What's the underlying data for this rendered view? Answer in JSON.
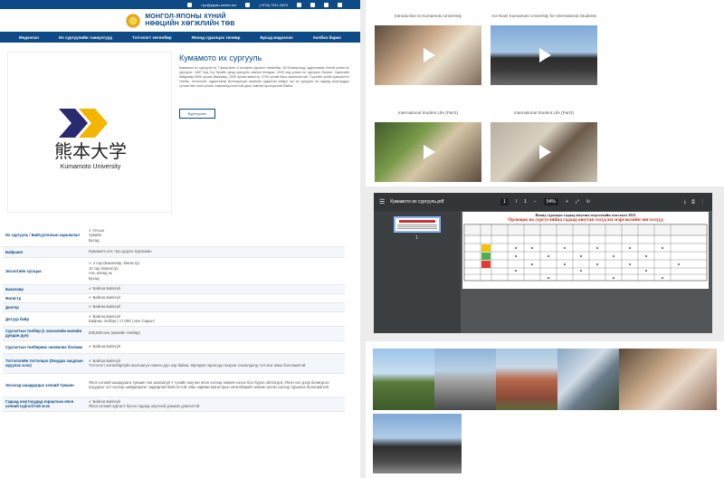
{
  "site": {
    "topbar_email": "nyc@japan-center.mn",
    "topbar_phone": "(+976) 7511-0879",
    "logo_line1": "МОНГОЛ-ЯПОНЫ ХҮНИЙ",
    "logo_line2": "НӨӨЦИЙН ХӨГЖЛИЙН ТӨВ",
    "nav": [
      "Мэдээлэл",
      "Их сургуулийн таниулгууд",
      "Тэтгэлэгт хөтөлбөр",
      "Японд суралцах төлөвр",
      "Бусад мэдээлэл",
      "Холбоо барих"
    ]
  },
  "university": {
    "title": "Кумамото их сургууль",
    "description": "Кумамото их сургууль нь 7 факультет, 6 аспиран туршилт хөтөлбөр, 26 болвсролуд, судалгааны тэнгэй улсын их сургууль. 1887 онд 5-р бүсийн дэнд сургууль хэмээн нээгдэж, 1949 онд улсын их сургууль болсон. Одоогийн байдлаар 8000 орчим бакалавр, 2000 орчим магистр, 2700 орчим багш ажиллагчтай. Сүүлийн үеийн дэвшилтэт техник, технологи, судалгааны бүтээгдэхүүн ашиглан судалгаа хийдэг тус их сургууль нь гадаад оюутнуудыг хүлээн авч олон улсын хэмжээнд нээлттэй дахь хамтын оролцоотой байна.",
    "button": "Бүртгүүлэх",
    "logo_kanji": "熊本大学",
    "logo_english": "Kumamoto University"
  },
  "info_table": [
    {
      "key": "Их сургууль / Байгууллагын харьяалал",
      "lines": [
        "✔ Улсын",
        "   Хувийн",
        "   Бусад"
      ]
    },
    {
      "key": "Байршил",
      "lines": [
        "Кумамото хот, Чуо дүүрэг, Курокамн"
      ]
    },
    {
      "key": "Элсэлтийн хугацаа",
      "lines": [
        "✔ 4 сар (Бакалавр, Магистр)",
        "   10 сар (Магистр)",
        "   Аль алинд нь",
        "   Бусад"
      ]
    },
    {
      "key": "Бакалавр",
      "lines": [
        "✔ Байгаа          Байхгүй"
      ]
    },
    {
      "key": "Магистр",
      "lines": [
        "✔ Байгаа          Байхгүй"
      ]
    },
    {
      "key": "Доктор",
      "lines": [
        "✔ Байгаа          Байхгүй"
      ]
    },
    {
      "key": "Дотуур байр",
      "lines": [
        "✔ Байгаа          Байхгүй",
        "   Байрны төлбөр (      17,000    ) иен /сарын/"
      ]
    },
    {
      "key": "Сургалтын төлбөр (1 хичээлийн жилийн дундаж дүн)",
      "lines": [
        "535,800 иен         (жилийн төлбөр)"
      ]
    },
    {
      "key": "Сургалтын төлбөрөөс чөлөөлөх боломж",
      "lines": [
        "✔ Байгаа          Байхгүй"
      ]
    },
    {
      "key": "Тэтгэлэгийн тогтолцоо (Оюудах засдлын оруулах эсэх)",
      "lines": [
        "✔ Байгаа          Байхгүй",
        "Тэтгэлэгт хөтөлбөргүйн шалгаагүн нэмэгн дүн нэр байна. Өргөдөл гаргасад гэнэрэн тохиолдолд тэтгэлэг авах болоомжтой."
      ]
    },
    {
      "key": "Элсэхэд шаардагдах хэлний түвшин",
      "lines": [
        "Япон хэлний шаардлага түвшин гэж заагаагүй ч тухайн оюутан япон хэлээр зөвхөн хэлэх бол бүрэн ойлгогдох; Япон хэл дээр бичигдсэн асуудлыг хэт хэлээр шийдвэрлэх чадвартай байх ёстой. Мөн заримо магистрын хөтөлбөрийг зөвхөн англи хэлээр туршлах болоомжтой."
      ]
    },
    {
      "key": "Гадаад оюутнуудад зориулсан япон хэлний сургалттай эсэх",
      "lines": [
        "✔ Байгаа          Байхгүй",
        "Япон хэлний сургалт бүлэн гадаад оюутнаб дэмжих дэвлэлтэй"
      ]
    }
  ],
  "videos": [
    {
      "caption": "Introduction to Kumamoto University"
    },
    {
      "caption": "Act Now! Kumamoto University for International Students"
    },
    {
      "caption": "International Student Life (Part1)"
    },
    {
      "caption": "International Student Life (Part2)"
    }
  ],
  "pdf": {
    "filename": "Кумамото их сургууль.pdf",
    "page": "1",
    "total": "1",
    "zoom": "54%",
    "thumb_page": "1",
    "title": "Японд суралцах гадаад оюутны мэдээллийн жагсаалт 2021",
    "subtitle": "Орлещок их сургуулийнд гадаад оюутан элсүүлэх мэргэжлийн чиглэлүүд"
  }
}
